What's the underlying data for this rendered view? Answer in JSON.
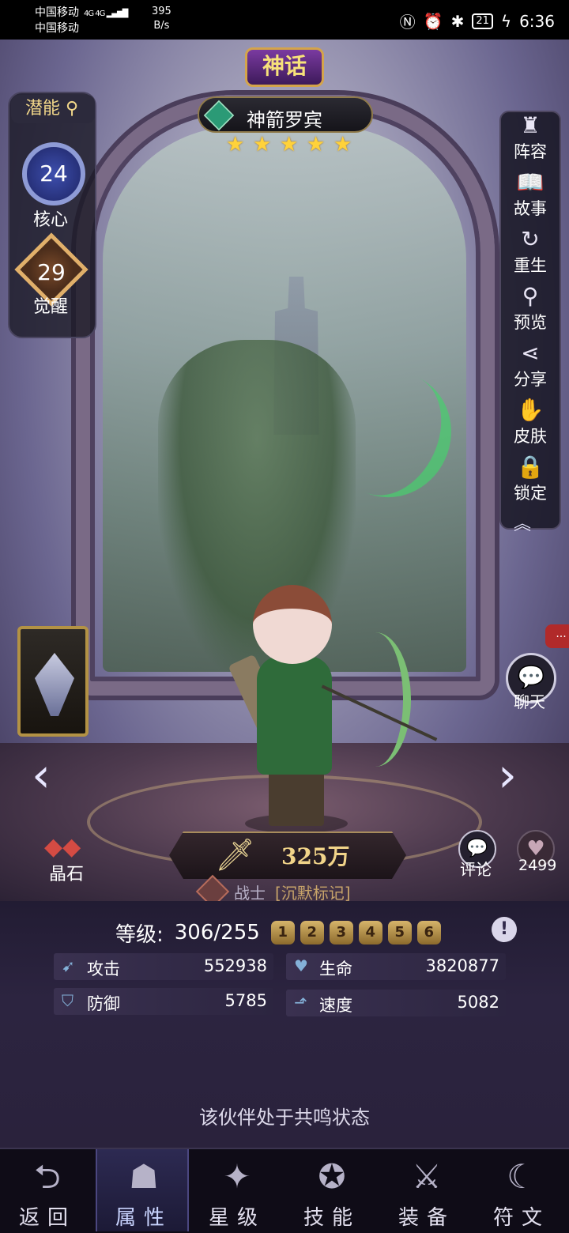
{
  "status_bar": {
    "carrier1": "中国移动",
    "carrier2": "中国移动",
    "signal": "4G 4G",
    "speed_value": "395",
    "speed_unit": "B/s",
    "battery": "21",
    "time": "6:36"
  },
  "hero": {
    "rarity": "神话",
    "name": "神箭罗宾",
    "stars": 5,
    "power": "325万",
    "class": "战士",
    "trait": "[沉默标记]"
  },
  "left_panel": {
    "potential_label": "潜能",
    "core_value": "24",
    "core_label": "核心",
    "awaken_value": "29",
    "awaken_label": "觉醒"
  },
  "side_menu": [
    {
      "label": "阵容",
      "icon": "lineup-icon"
    },
    {
      "label": "故事",
      "icon": "story-book-icon"
    },
    {
      "label": "重生",
      "icon": "rebirth-icon"
    },
    {
      "label": "预览",
      "icon": "preview-magnifier-icon"
    },
    {
      "label": "分享",
      "icon": "share-icon"
    },
    {
      "label": "皮肤",
      "icon": "skin-icon"
    },
    {
      "label": "锁定",
      "icon": "lock-icon"
    }
  ],
  "chat": {
    "label": "聊天",
    "badge": "..."
  },
  "crystal": {
    "label": "晶石"
  },
  "review": {
    "label": "评论"
  },
  "likes": {
    "count": "2499"
  },
  "level": {
    "label": "等级:",
    "value": "306/255",
    "tiers": [
      "1",
      "2",
      "3",
      "4",
      "5",
      "6"
    ]
  },
  "stats": {
    "attack": {
      "label": "攻击",
      "value": "552938"
    },
    "hp": {
      "label": "生命",
      "value": "3820877"
    },
    "defense": {
      "label": "防御",
      "value": "5785"
    },
    "speed": {
      "label": "速度",
      "value": "5082"
    }
  },
  "resonance_text": "该伙伴处于共鸣状态",
  "bottom_nav": [
    {
      "label": "返回",
      "icon": "back-icon"
    },
    {
      "label": "属性",
      "icon": "attributes-icon"
    },
    {
      "label": "星级",
      "icon": "star-level-icon"
    },
    {
      "label": "技能",
      "icon": "skills-icon"
    },
    {
      "label": "装备",
      "icon": "equipment-icon"
    },
    {
      "label": "符文",
      "icon": "rune-icon"
    }
  ],
  "colors": {
    "accent_gold": "#f1d489",
    "star": "#ffd23a",
    "panel_bg": "#2c2440"
  }
}
